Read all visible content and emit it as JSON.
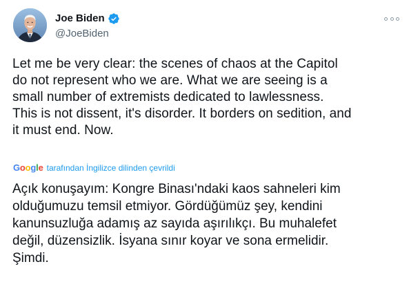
{
  "author": {
    "display_name": "Joe Biden",
    "handle": "@JoeBiden",
    "verified_icon": "verified-badge-icon",
    "avatar_icon": "avatar"
  },
  "menu": {
    "icon": "more-options-icon"
  },
  "tweet": {
    "lines": [
      "Let me be very clear: the scenes of chaos at the Capitol",
      "do not represent who we are. What we are seeing is a",
      "small number of extremists dedicated to lawlessness.",
      "This is not dissent, it's disorder. It borders on sedition, and",
      "it must end. Now."
    ]
  },
  "translation": {
    "logo_text": "Google",
    "label": "tarafından İngilizce dilinden çevrildi",
    "lines": [
      "Açık konuşayım: Kongre Binası'ndaki kaos sahneleri kim",
      "olduğumuzu temsil etmiyor. Gördüğümüz şey, kendini",
      "kanunsuzluğa adamış az sayıda aşırılıkçı. Bu muhalefet",
      "değil, düzensizlik. İsyana sınır koyar ve sona ermelidir.",
      "Şimdi."
    ]
  },
  "colors": {
    "verified_blue": "#1d9bf0",
    "link_blue": "#1d9bf0",
    "text": "#0f1419",
    "muted": "#536471",
    "google_blue": "#4285f4",
    "google_red": "#ea4335",
    "google_yellow": "#fbbc05",
    "google_green": "#34a853"
  }
}
